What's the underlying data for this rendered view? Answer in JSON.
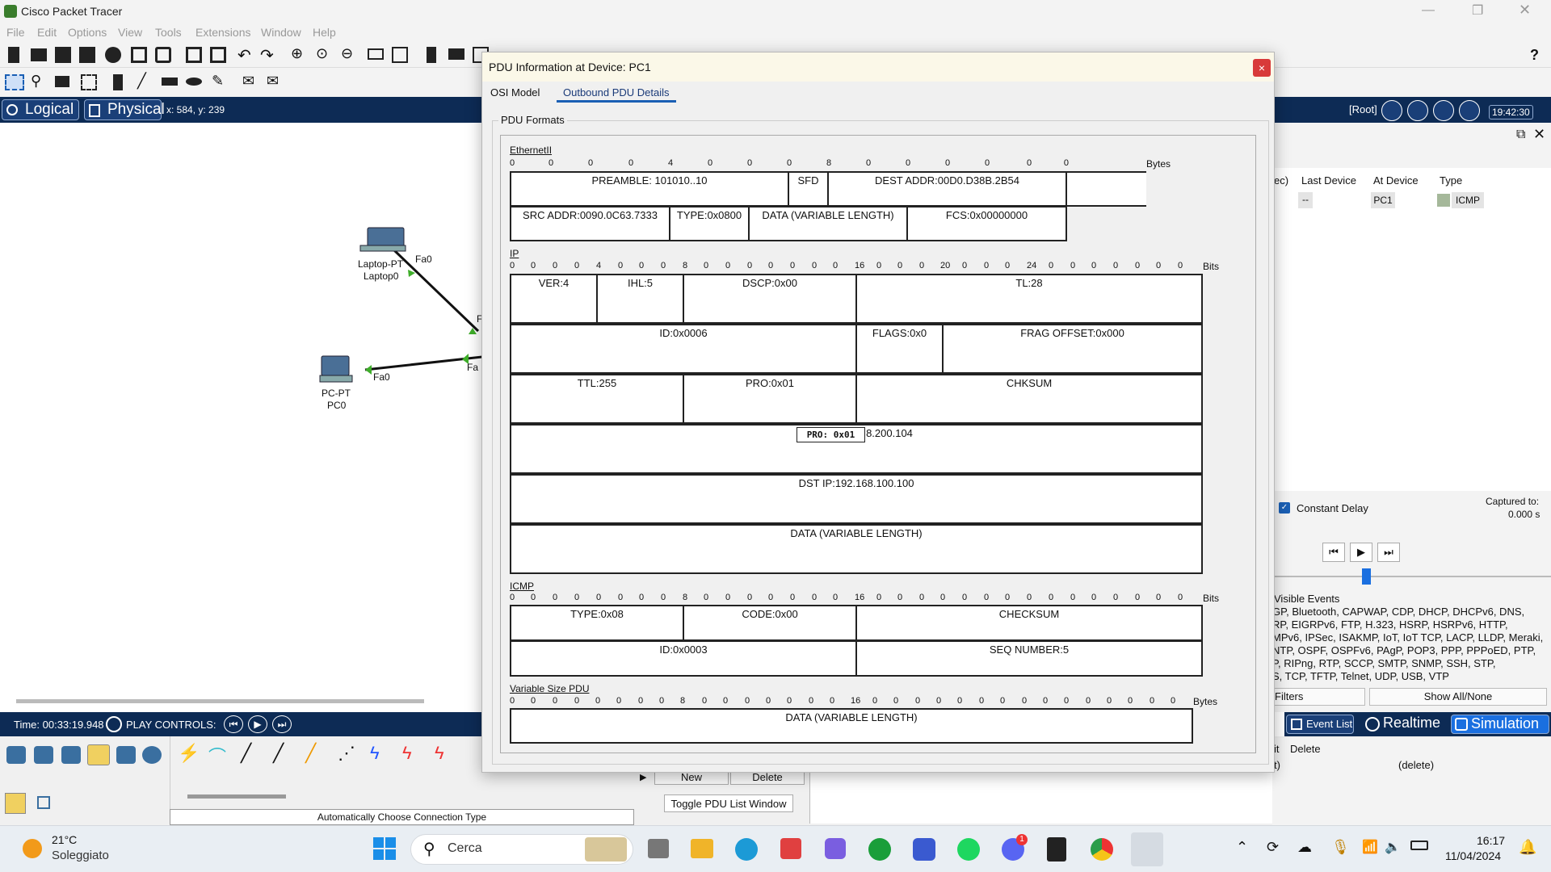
{
  "app": {
    "title": "Cisco Packet Tracer"
  },
  "menu": [
    "File",
    "Edit",
    "Options",
    "View",
    "Tools",
    "Extensions",
    "Window",
    "Help"
  ],
  "mode_tabs": {
    "logical": "Logical",
    "physical": "Physical",
    "coords": "x: 584, y: 239"
  },
  "topology": {
    "laptop_type": "Laptop-PT",
    "laptop_name": "Laptop0",
    "laptop_port": "Fa0",
    "pc_type": "PC-PT",
    "pc_name": "PC0",
    "pc_port": "Fa0",
    "switch_port1": "F",
    "switch_port2": "Fa"
  },
  "time_bar": {
    "time": "Time: 00:33:19.948",
    "play_controls": "PLAY CONTROLS:"
  },
  "connection_hint": "Automatically Choose Connection Type",
  "pdu_list": {
    "new": "New",
    "delete": "Delete",
    "toggle": "Toggle PDU List Window"
  },
  "right_panel": {
    "root": "[Root]",
    "clock": "19:42:30",
    "columns": [
      "ec)",
      "Last Device",
      "At Device",
      "Type"
    ],
    "row": {
      "last": "--",
      "at": "PC1",
      "type": "ICMP"
    },
    "constant_delay": "Constant Delay",
    "captured_to": "Captured to:",
    "captured_val": "0.000 s",
    "visible_events": "Visible Events",
    "event_lines": [
      "GP, Bluetooth, CAPWAP, CDP, DHCP, DHCPv6, DNS,",
      "RP, EIGRPv6, FTP, H.323, HSRP, HSRPv6, HTTP,",
      "MPv6, IPSec, ISAKMP, IoT, IoT TCP, LACP, LLDP, Meraki,",
      "NTP, OSPF, OSPFv6, PAgP, POP3, PPP, PPPoED, PTP,",
      "P, RIPng, RTP, SCCP, SMTP, SNMP, SSH, STP,",
      "S, TCP, TFTP, Telnet, UDP, USB, VTP"
    ],
    "filters": "Filters",
    "show_all": "Show All/None",
    "event_list": "Event List",
    "realtime": "Realtime",
    "simulation": "Simulation",
    "lower_cols": [
      "it",
      "Delete"
    ],
    "lower_row": [
      "t)",
      "(delete)"
    ]
  },
  "dialog": {
    "title": "PDU Information at Device: PC1",
    "close": "×",
    "tabs": [
      "OSI Model",
      "Outbound PDU Details"
    ],
    "group_label": "PDU Formats",
    "ethernet": {
      "label": "EthernetII",
      "ruler": [
        "0",
        "4",
        "8"
      ],
      "unit": "Bytes",
      "row1": [
        "PREAMBLE: 101010..10",
        "SFD",
        "DEST ADDR:00D0.D38B.2B54",
        ""
      ],
      "row2": [
        "SRC ADDR:0090.0C63.7333",
        "TYPE:0x0800",
        "DATA (VARIABLE LENGTH)",
        "FCS:0x00000000"
      ]
    },
    "ip": {
      "label": "IP",
      "ruler": [
        "0",
        "4",
        "8",
        "16",
        "20",
        "24"
      ],
      "unit": "Bits",
      "row1": [
        "VER:4",
        "IHL:5",
        "DSCP:0x00",
        "TL:28"
      ],
      "row2": [
        "ID:0x0006",
        "FLAGS:0x0",
        "FRAG OFFSET:0x000"
      ],
      "row3": [
        "TTL:255",
        "PRO:0x01",
        "CHKSUM"
      ],
      "row4": "8.200.104",
      "tooltip": "PRO: 0x01",
      "row5": "DST IP:192.168.100.100",
      "row6": "DATA (VARIABLE LENGTH)"
    },
    "icmp": {
      "label": "ICMP",
      "ruler": [
        "0",
        "8",
        "16"
      ],
      "unit": "Bits",
      "row1": [
        "TYPE:0x08",
        "CODE:0x00",
        "CHECKSUM"
      ],
      "row2": [
        "ID:0x0003",
        "SEQ NUMBER:5"
      ]
    },
    "varpdu": {
      "label": "Variable Size PDU",
      "ruler": [
        "0",
        "8",
        "16"
      ],
      "unit": "Bytes",
      "row1": "DATA (VARIABLE LENGTH)"
    }
  },
  "taskbar": {
    "weather_temp": "21°C",
    "weather_desc": "Soleggiato",
    "search": "Cerca",
    "time": "16:17",
    "date": "11/04/2024",
    "discord_badge": "1"
  }
}
